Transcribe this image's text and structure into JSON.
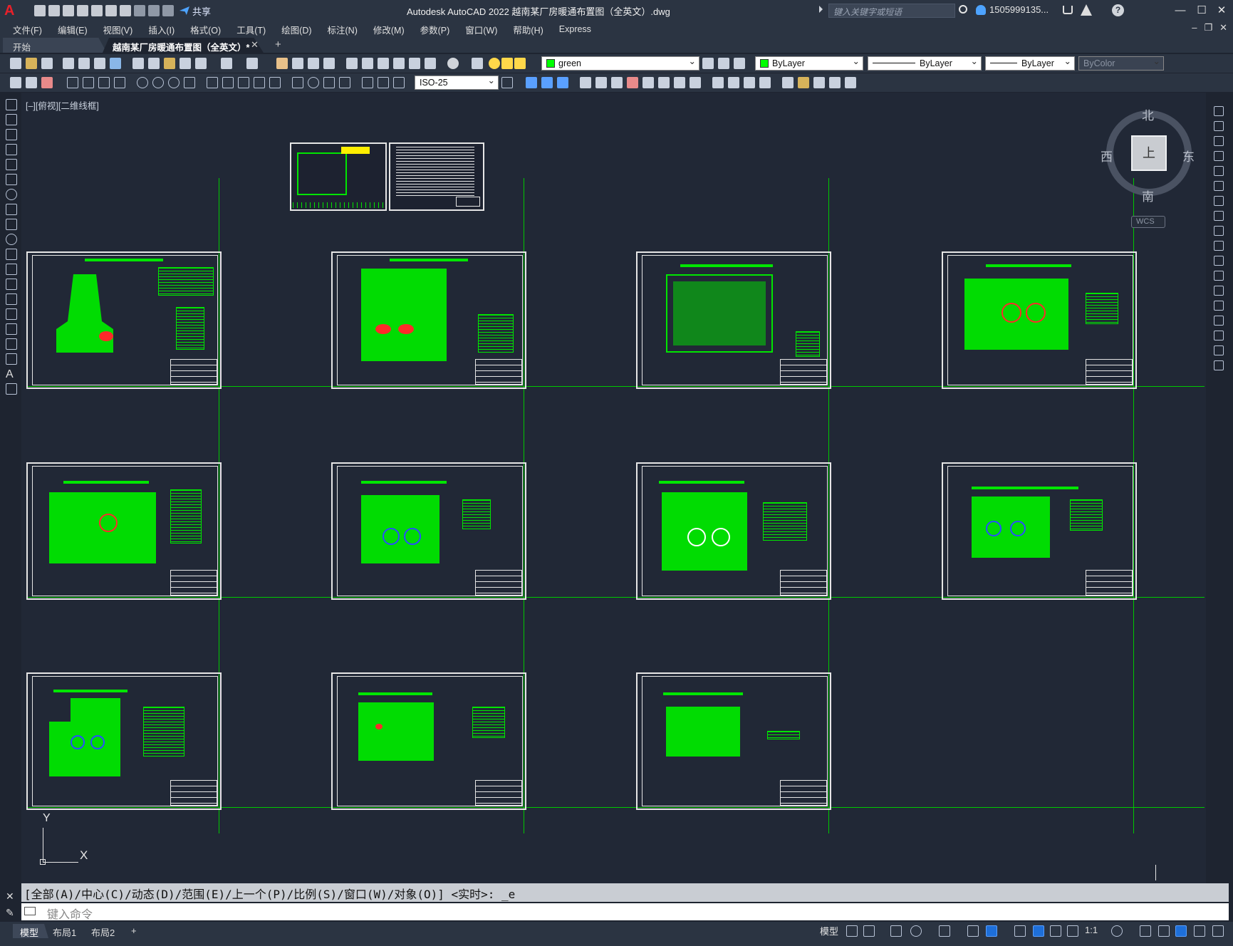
{
  "app": {
    "window_title": "Autodesk AutoCAD 2022    越南某厂房暖通布置图（全英文）.dwg",
    "share_label": "共享",
    "search_placeholder": "键入关键字或短语",
    "user_name": "1505999135...",
    "help_glyph": "?",
    "minimize": "—",
    "restore": "☐",
    "close": "✕"
  },
  "menu": [
    "文件(F)",
    "编辑(E)",
    "视图(V)",
    "插入(I)",
    "格式(O)",
    "工具(T)",
    "绘图(D)",
    "标注(N)",
    "修改(M)",
    "参数(P)",
    "窗口(W)",
    "帮助(H)",
    "Express"
  ],
  "tabs": {
    "start": "开始",
    "active": "越南某厂房暖通布置图（全英文）*",
    "close": "✕",
    "add": "+"
  },
  "properties": {
    "layer": "green",
    "color": "ByLayer",
    "linetype": "ByLayer",
    "lineweight": "ByLayer",
    "plotstyle": "ByColor",
    "dimstyle": "ISO-25",
    "layer_color_hex": "#00ff00"
  },
  "viewport": {
    "label": "[–][俯视][二维线框]"
  },
  "viewcube": {
    "north": "北",
    "south": "南",
    "east": "东",
    "west": "西",
    "top": "上",
    "wcs": "WCS"
  },
  "ucs": {
    "x": "X",
    "y": "Y"
  },
  "command": {
    "history": "[全部(A)/中心(C)/动态(D)/范围(E)/上一个(P)/比例(S)/窗口(W)/对象(O)] <实时>: _e",
    "placeholder": "键入命令"
  },
  "layouts": [
    "模型",
    "布局1",
    "布局2"
  ],
  "layout_add": "+",
  "status": {
    "model": "模型",
    "scale": "1:1"
  },
  "colors": {
    "background": "#212836",
    "chrome": "#2b3442",
    "drawing_green": "#00e600",
    "accent_blue": "#1e6fd9"
  }
}
